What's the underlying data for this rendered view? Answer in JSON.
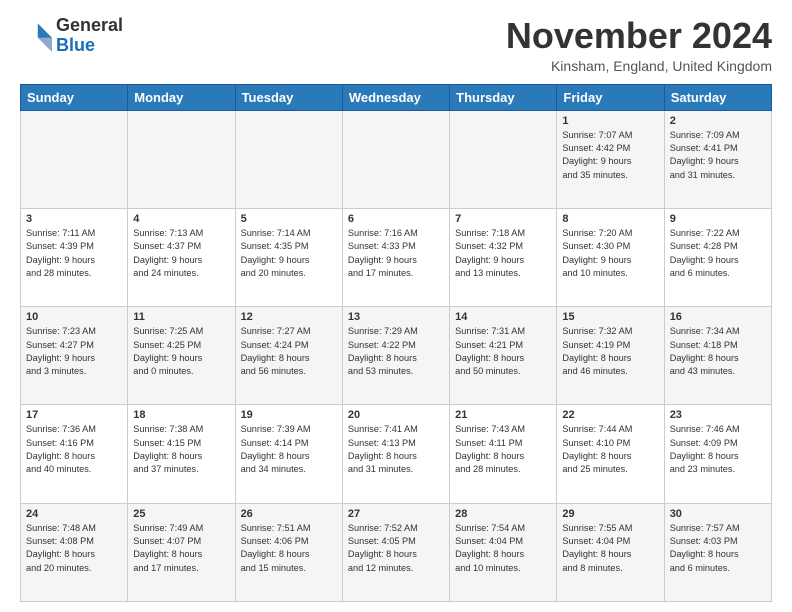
{
  "logo": {
    "general": "General",
    "blue": "Blue"
  },
  "header": {
    "title": "November 2024",
    "location": "Kinsham, England, United Kingdom"
  },
  "weekdays": [
    "Sunday",
    "Monday",
    "Tuesday",
    "Wednesday",
    "Thursday",
    "Friday",
    "Saturday"
  ],
  "weeks": [
    [
      {
        "day": "",
        "info": ""
      },
      {
        "day": "",
        "info": ""
      },
      {
        "day": "",
        "info": ""
      },
      {
        "day": "",
        "info": ""
      },
      {
        "day": "",
        "info": ""
      },
      {
        "day": "1",
        "info": "Sunrise: 7:07 AM\nSunset: 4:42 PM\nDaylight: 9 hours\nand 35 minutes."
      },
      {
        "day": "2",
        "info": "Sunrise: 7:09 AM\nSunset: 4:41 PM\nDaylight: 9 hours\nand 31 minutes."
      }
    ],
    [
      {
        "day": "3",
        "info": "Sunrise: 7:11 AM\nSunset: 4:39 PM\nDaylight: 9 hours\nand 28 minutes."
      },
      {
        "day": "4",
        "info": "Sunrise: 7:13 AM\nSunset: 4:37 PM\nDaylight: 9 hours\nand 24 minutes."
      },
      {
        "day": "5",
        "info": "Sunrise: 7:14 AM\nSunset: 4:35 PM\nDaylight: 9 hours\nand 20 minutes."
      },
      {
        "day": "6",
        "info": "Sunrise: 7:16 AM\nSunset: 4:33 PM\nDaylight: 9 hours\nand 17 minutes."
      },
      {
        "day": "7",
        "info": "Sunrise: 7:18 AM\nSunset: 4:32 PM\nDaylight: 9 hours\nand 13 minutes."
      },
      {
        "day": "8",
        "info": "Sunrise: 7:20 AM\nSunset: 4:30 PM\nDaylight: 9 hours\nand 10 minutes."
      },
      {
        "day": "9",
        "info": "Sunrise: 7:22 AM\nSunset: 4:28 PM\nDaylight: 9 hours\nand 6 minutes."
      }
    ],
    [
      {
        "day": "10",
        "info": "Sunrise: 7:23 AM\nSunset: 4:27 PM\nDaylight: 9 hours\nand 3 minutes."
      },
      {
        "day": "11",
        "info": "Sunrise: 7:25 AM\nSunset: 4:25 PM\nDaylight: 9 hours\nand 0 minutes."
      },
      {
        "day": "12",
        "info": "Sunrise: 7:27 AM\nSunset: 4:24 PM\nDaylight: 8 hours\nand 56 minutes."
      },
      {
        "day": "13",
        "info": "Sunrise: 7:29 AM\nSunset: 4:22 PM\nDaylight: 8 hours\nand 53 minutes."
      },
      {
        "day": "14",
        "info": "Sunrise: 7:31 AM\nSunset: 4:21 PM\nDaylight: 8 hours\nand 50 minutes."
      },
      {
        "day": "15",
        "info": "Sunrise: 7:32 AM\nSunset: 4:19 PM\nDaylight: 8 hours\nand 46 minutes."
      },
      {
        "day": "16",
        "info": "Sunrise: 7:34 AM\nSunset: 4:18 PM\nDaylight: 8 hours\nand 43 minutes."
      }
    ],
    [
      {
        "day": "17",
        "info": "Sunrise: 7:36 AM\nSunset: 4:16 PM\nDaylight: 8 hours\nand 40 minutes."
      },
      {
        "day": "18",
        "info": "Sunrise: 7:38 AM\nSunset: 4:15 PM\nDaylight: 8 hours\nand 37 minutes."
      },
      {
        "day": "19",
        "info": "Sunrise: 7:39 AM\nSunset: 4:14 PM\nDaylight: 8 hours\nand 34 minutes."
      },
      {
        "day": "20",
        "info": "Sunrise: 7:41 AM\nSunset: 4:13 PM\nDaylight: 8 hours\nand 31 minutes."
      },
      {
        "day": "21",
        "info": "Sunrise: 7:43 AM\nSunset: 4:11 PM\nDaylight: 8 hours\nand 28 minutes."
      },
      {
        "day": "22",
        "info": "Sunrise: 7:44 AM\nSunset: 4:10 PM\nDaylight: 8 hours\nand 25 minutes."
      },
      {
        "day": "23",
        "info": "Sunrise: 7:46 AM\nSunset: 4:09 PM\nDaylight: 8 hours\nand 23 minutes."
      }
    ],
    [
      {
        "day": "24",
        "info": "Sunrise: 7:48 AM\nSunset: 4:08 PM\nDaylight: 8 hours\nand 20 minutes."
      },
      {
        "day": "25",
        "info": "Sunrise: 7:49 AM\nSunset: 4:07 PM\nDaylight: 8 hours\nand 17 minutes."
      },
      {
        "day": "26",
        "info": "Sunrise: 7:51 AM\nSunset: 4:06 PM\nDaylight: 8 hours\nand 15 minutes."
      },
      {
        "day": "27",
        "info": "Sunrise: 7:52 AM\nSunset: 4:05 PM\nDaylight: 8 hours\nand 12 minutes."
      },
      {
        "day": "28",
        "info": "Sunrise: 7:54 AM\nSunset: 4:04 PM\nDaylight: 8 hours\nand 10 minutes."
      },
      {
        "day": "29",
        "info": "Sunrise: 7:55 AM\nSunset: 4:04 PM\nDaylight: 8 hours\nand 8 minutes."
      },
      {
        "day": "30",
        "info": "Sunrise: 7:57 AM\nSunset: 4:03 PM\nDaylight: 8 hours\nand 6 minutes."
      }
    ]
  ]
}
